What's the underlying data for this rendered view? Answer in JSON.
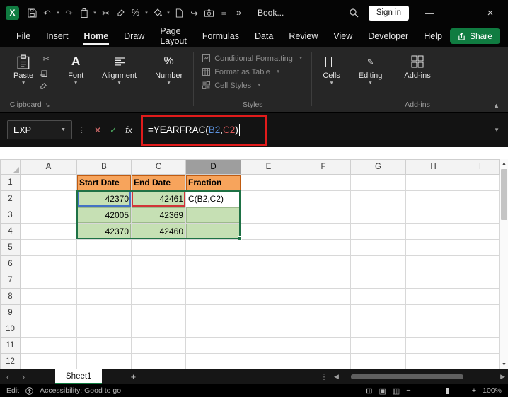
{
  "colors": {
    "excel_green": "#107C41",
    "annotation_red": "#E11B1B",
    "ref_blue": "#4472C4",
    "ref_red": "#D13438",
    "cell_green": "#C6E0B4",
    "cell_orange": "#F7A45C"
  },
  "titlebar": {
    "title": "Book...",
    "overflow": "»",
    "sign_in": "Sign in",
    "minimize": "—",
    "close": "×"
  },
  "menubar": {
    "tabs": [
      "File",
      "Insert",
      "Home",
      "Draw",
      "Page Layout",
      "Formulas",
      "Data",
      "Review",
      "View",
      "Developer",
      "Help"
    ],
    "active_tab": "Home",
    "share": "Share"
  },
  "ribbon": {
    "paste": "Paste",
    "font": "Font",
    "alignment": "Alignment",
    "number": "Number",
    "styles_items": [
      "Conditional Formatting",
      "Format as Table",
      "Cell Styles"
    ],
    "cells": "Cells",
    "editing": "Editing",
    "addins": "Add-ins",
    "group_clipboard": "Clipboard",
    "group_styles": "Styles",
    "group_addins": "Add-ins"
  },
  "formula_bar": {
    "name_box": "EXP",
    "cancel": "✕",
    "enter": "✓",
    "fx": "fx",
    "formula_prefix": "=YEARFRAC(",
    "formula_ref1": "B2",
    "formula_comma": ",",
    "formula_ref2": "C2",
    "formula_close": ")"
  },
  "grid": {
    "columns": [
      "A",
      "B",
      "C",
      "D",
      "E",
      "F",
      "G",
      "H",
      "I"
    ],
    "selected_column": "D",
    "row_count": 12,
    "selection_range": "B2:D4",
    "active_cell": "D2",
    "cells": [
      {
        "ref": "B1",
        "text": "Start Date",
        "style": "orange"
      },
      {
        "ref": "C1",
        "text": "End Date",
        "style": "orange"
      },
      {
        "ref": "D1",
        "text": "Fraction",
        "style": "orange"
      },
      {
        "ref": "B2",
        "text": "42370",
        "style": "green num ref-blue"
      },
      {
        "ref": "C2",
        "text": "42461",
        "style": "green num ref-red"
      },
      {
        "ref": "D2",
        "text": "C(B2,C2)",
        "style": "edit"
      },
      {
        "ref": "B3",
        "text": "42005",
        "style": "green num"
      },
      {
        "ref": "C3",
        "text": "42369",
        "style": "green num"
      },
      {
        "ref": "D3",
        "text": "",
        "style": "green"
      },
      {
        "ref": "B4",
        "text": "42370",
        "style": "green num"
      },
      {
        "ref": "C4",
        "text": "42460",
        "style": "green num"
      },
      {
        "ref": "D4",
        "text": "",
        "style": "green"
      }
    ]
  },
  "sheetbar": {
    "tab": "Sheet1",
    "add": "+"
  },
  "statusbar": {
    "mode": "Edit",
    "accessibility": "Accessibility: Good to go",
    "zoom": "100%"
  }
}
